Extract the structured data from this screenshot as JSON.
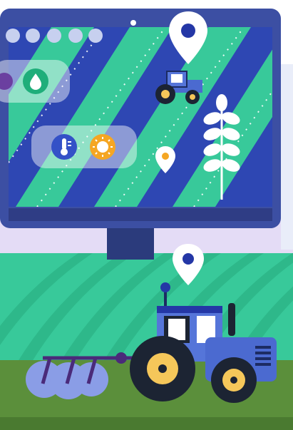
{
  "scene": {
    "monitor": {
      "icons": [
        "dot-icon",
        "dot-icon",
        "dot-icon",
        "dot-icon",
        "dot-icon"
      ],
      "weather_panel": [
        "thermometer-icon",
        "sun-icon"
      ],
      "water_panel": [
        "water-drop-icon"
      ],
      "map_pins": [
        "location-pin-icon",
        "location-pin-icon"
      ],
      "vehicle": "tractor-icon",
      "crop": "wheat-icon"
    },
    "foreground": {
      "pin": "location-pin-icon",
      "vehicle": "tractor-icon",
      "implement": "cultivator-icon"
    },
    "colors": {
      "screen_blue": "#2e47b3",
      "stripe_green": "#38c99a",
      "tractor_blue": "#4b6ad0",
      "ground_green": "#5b8f3b",
      "sun_orange": "#f5a623"
    }
  }
}
